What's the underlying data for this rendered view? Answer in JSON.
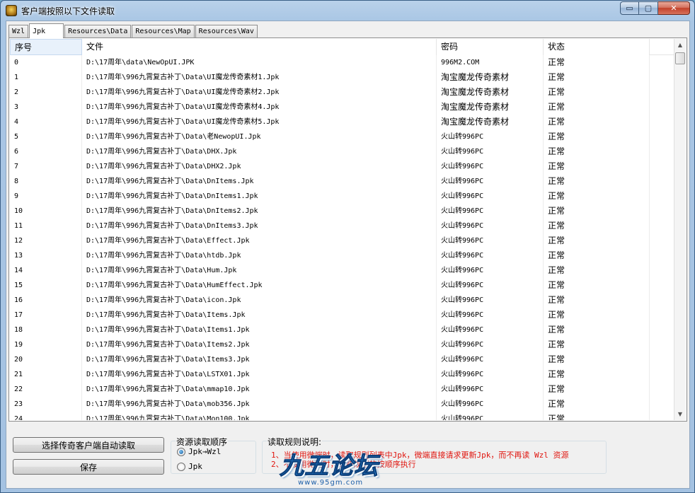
{
  "window": {
    "title": "客户端按照以下文件读取",
    "min_glyph": "▭",
    "max_glyph": "▢",
    "close_glyph": "✕"
  },
  "tabs": [
    {
      "label": "Wzl",
      "active": false
    },
    {
      "label": "Jpk",
      "active": true
    },
    {
      "label": "Resources\\Data",
      "active": false
    },
    {
      "label": "Resources\\Map",
      "active": false
    },
    {
      "label": "Resources\\Wav",
      "active": false
    }
  ],
  "list": {
    "columns": [
      "序号",
      "文件",
      "密码",
      "状态"
    ],
    "rows": [
      [
        "0",
        "D:\\17周年\\data\\NewOpUI.JPK",
        "996M2.COM",
        "正常"
      ],
      [
        "1",
        "D:\\17周年\\996九霄复古补丁\\Data\\UI魔龙传奇素材1.Jpk",
        "淘宝魔龙传奇素材",
        "正常"
      ],
      [
        "2",
        "D:\\17周年\\996九霄复古补丁\\Data\\UI魔龙传奇素材2.Jpk",
        "淘宝魔龙传奇素材",
        "正常"
      ],
      [
        "3",
        "D:\\17周年\\996九霄复古补丁\\Data\\UI魔龙传奇素材4.Jpk",
        "淘宝魔龙传奇素材",
        "正常"
      ],
      [
        "4",
        "D:\\17周年\\996九霄复古补丁\\Data\\UI魔龙传奇素材5.Jpk",
        "淘宝魔龙传奇素材",
        "正常"
      ],
      [
        "5",
        "D:\\17周年\\996九霄复古补丁\\Data\\老NewopUI.Jpk",
        "火山转996PC",
        "正常"
      ],
      [
        "6",
        "D:\\17周年\\996九霄复古补丁\\Data\\DHX.Jpk",
        "火山转996PC",
        "正常"
      ],
      [
        "7",
        "D:\\17周年\\996九霄复古补丁\\Data\\DHX2.Jpk",
        "火山转996PC",
        "正常"
      ],
      [
        "8",
        "D:\\17周年\\996九霄复古补丁\\Data\\DnItems.Jpk",
        "火山转996PC",
        "正常"
      ],
      [
        "9",
        "D:\\17周年\\996九霄复古补丁\\Data\\DnItems1.Jpk",
        "火山转996PC",
        "正常"
      ],
      [
        "10",
        "D:\\17周年\\996九霄复古补丁\\Data\\DnItems2.Jpk",
        "火山转996PC",
        "正常"
      ],
      [
        "11",
        "D:\\17周年\\996九霄复古补丁\\Data\\DnItems3.Jpk",
        "火山转996PC",
        "正常"
      ],
      [
        "12",
        "D:\\17周年\\996九霄复古补丁\\Data\\Effect.Jpk",
        "火山转996PC",
        "正常"
      ],
      [
        "13",
        "D:\\17周年\\996九霄复古补丁\\Data\\htdb.Jpk",
        "火山转996PC",
        "正常"
      ],
      [
        "14",
        "D:\\17周年\\996九霄复古补丁\\Data\\Hum.Jpk",
        "火山转996PC",
        "正常"
      ],
      [
        "15",
        "D:\\17周年\\996九霄复古补丁\\Data\\HumEffect.Jpk",
        "火山转996PC",
        "正常"
      ],
      [
        "16",
        "D:\\17周年\\996九霄复古补丁\\Data\\icon.Jpk",
        "火山转996PC",
        "正常"
      ],
      [
        "17",
        "D:\\17周年\\996九霄复古补丁\\Data\\Items.Jpk",
        "火山转996PC",
        "正常"
      ],
      [
        "18",
        "D:\\17周年\\996九霄复古补丁\\Data\\Items1.Jpk",
        "火山转996PC",
        "正常"
      ],
      [
        "19",
        "D:\\17周年\\996九霄复古补丁\\Data\\Items2.Jpk",
        "火山转996PC",
        "正常"
      ],
      [
        "20",
        "D:\\17周年\\996九霄复古补丁\\Data\\Items3.Jpk",
        "火山转996PC",
        "正常"
      ],
      [
        "21",
        "D:\\17周年\\996九霄复古补丁\\Data\\LSTX01.Jpk",
        "火山转996PC",
        "正常"
      ],
      [
        "22",
        "D:\\17周年\\996九霄复古补丁\\Data\\mmap10.Jpk",
        "火山转996PC",
        "正常"
      ],
      [
        "23",
        "D:\\17周年\\996九霄复古补丁\\Data\\mob356.Jpk",
        "火山转996PC",
        "正常"
      ],
      [
        "24",
        "D:\\17周年\\996九霄复古补丁\\Data\\Mon100.Jpk",
        "火山转996PC",
        "正常"
      ]
    ]
  },
  "buttons": {
    "auto_read": "选择传奇客户端自动读取",
    "save": "保存"
  },
  "order_group": {
    "title": "资源读取顺序",
    "options": [
      {
        "label": "Jpk→Wzl",
        "selected": true
      },
      {
        "label": "Jpk",
        "selected": false
      }
    ]
  },
  "rules_group": {
    "title": "读取规则说明:",
    "line1": "1、当使用微端时，读取规则列表中Jpk，微端直接请求更新Jpk，而不再读 Wzl 资源",
    "line2": "2、不使用微端时，读取规则的按顺序执行"
  },
  "watermark": {
    "text": "九五论坛",
    "url": "www.95gm.com"
  },
  "colors": {
    "rule_text": "#e0150e",
    "selection_header": "#e8f1fb"
  }
}
